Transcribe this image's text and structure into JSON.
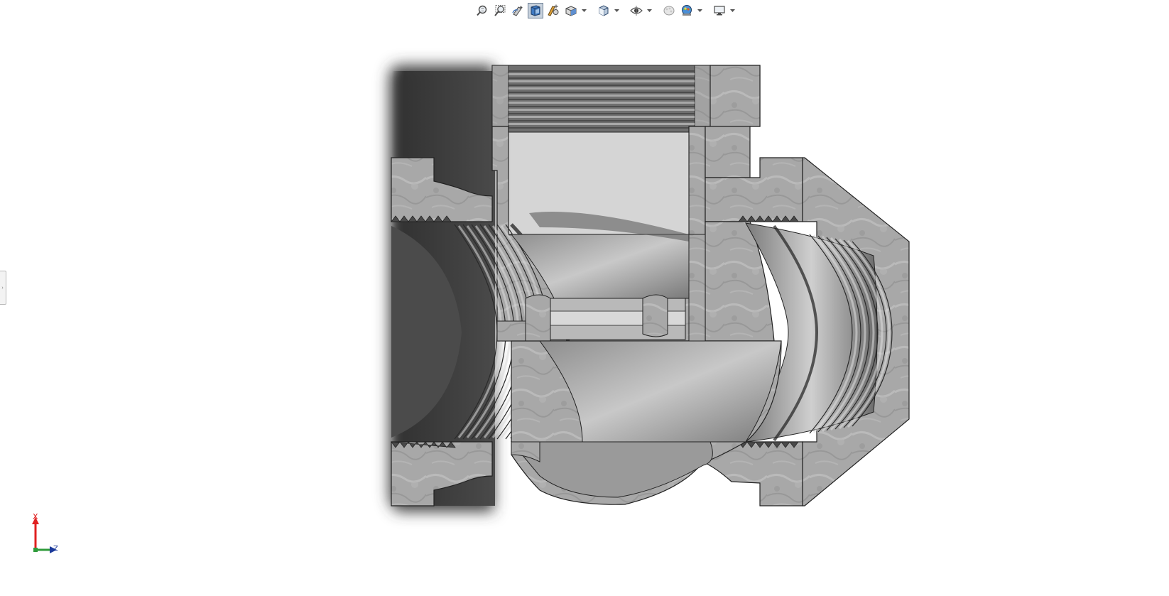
{
  "toolbar": {
    "buttons": [
      {
        "name": "zoom-to-fit",
        "icon": "zoom-to-fit-icon",
        "dropdown": false,
        "active": false
      },
      {
        "name": "zoom-to-area",
        "icon": "zoom-to-area-icon",
        "dropdown": false,
        "active": false
      },
      {
        "name": "previous-view",
        "icon": "previous-view-icon",
        "dropdown": false,
        "active": false
      },
      {
        "name": "section-view",
        "icon": "section-view-icon",
        "dropdown": false,
        "active": true
      },
      {
        "name": "dynamic-annotation-views",
        "icon": "dynamic-annotation-icon",
        "dropdown": false,
        "active": false
      },
      {
        "name": "view-orientation",
        "icon": "view-orientation-icon",
        "dropdown": true,
        "active": false
      },
      {
        "name": "display-style",
        "icon": "display-style-icon",
        "dropdown": true,
        "active": false
      },
      {
        "name": "hide-show-items",
        "icon": "hide-show-eye-icon",
        "dropdown": true,
        "active": false
      },
      {
        "name": "edit-appearance",
        "icon": "edit-appearance-icon",
        "dropdown": false,
        "active": false
      },
      {
        "name": "apply-scene",
        "icon": "apply-scene-icon",
        "dropdown": true,
        "active": false
      },
      {
        "name": "view-settings",
        "icon": "view-settings-monitor-icon",
        "dropdown": true,
        "active": false
      }
    ]
  },
  "panel_tab": {
    "icon": "expand-panel-arrow-icon",
    "glyph": "›"
  },
  "triad": {
    "x_label": "X",
    "z_label": "Z"
  },
  "colors": {
    "background": "#ffffff",
    "metal_light": "#c4c4c4",
    "metal_mid": "#9c9c9c",
    "metal_dark": "#5a5a5a",
    "shadow": "#3c3c3c",
    "triad_x": "#e02020",
    "triad_y": "#2e9b3a",
    "triad_z": "#1b3a9a",
    "toolbar_active": "#c9d3de"
  }
}
